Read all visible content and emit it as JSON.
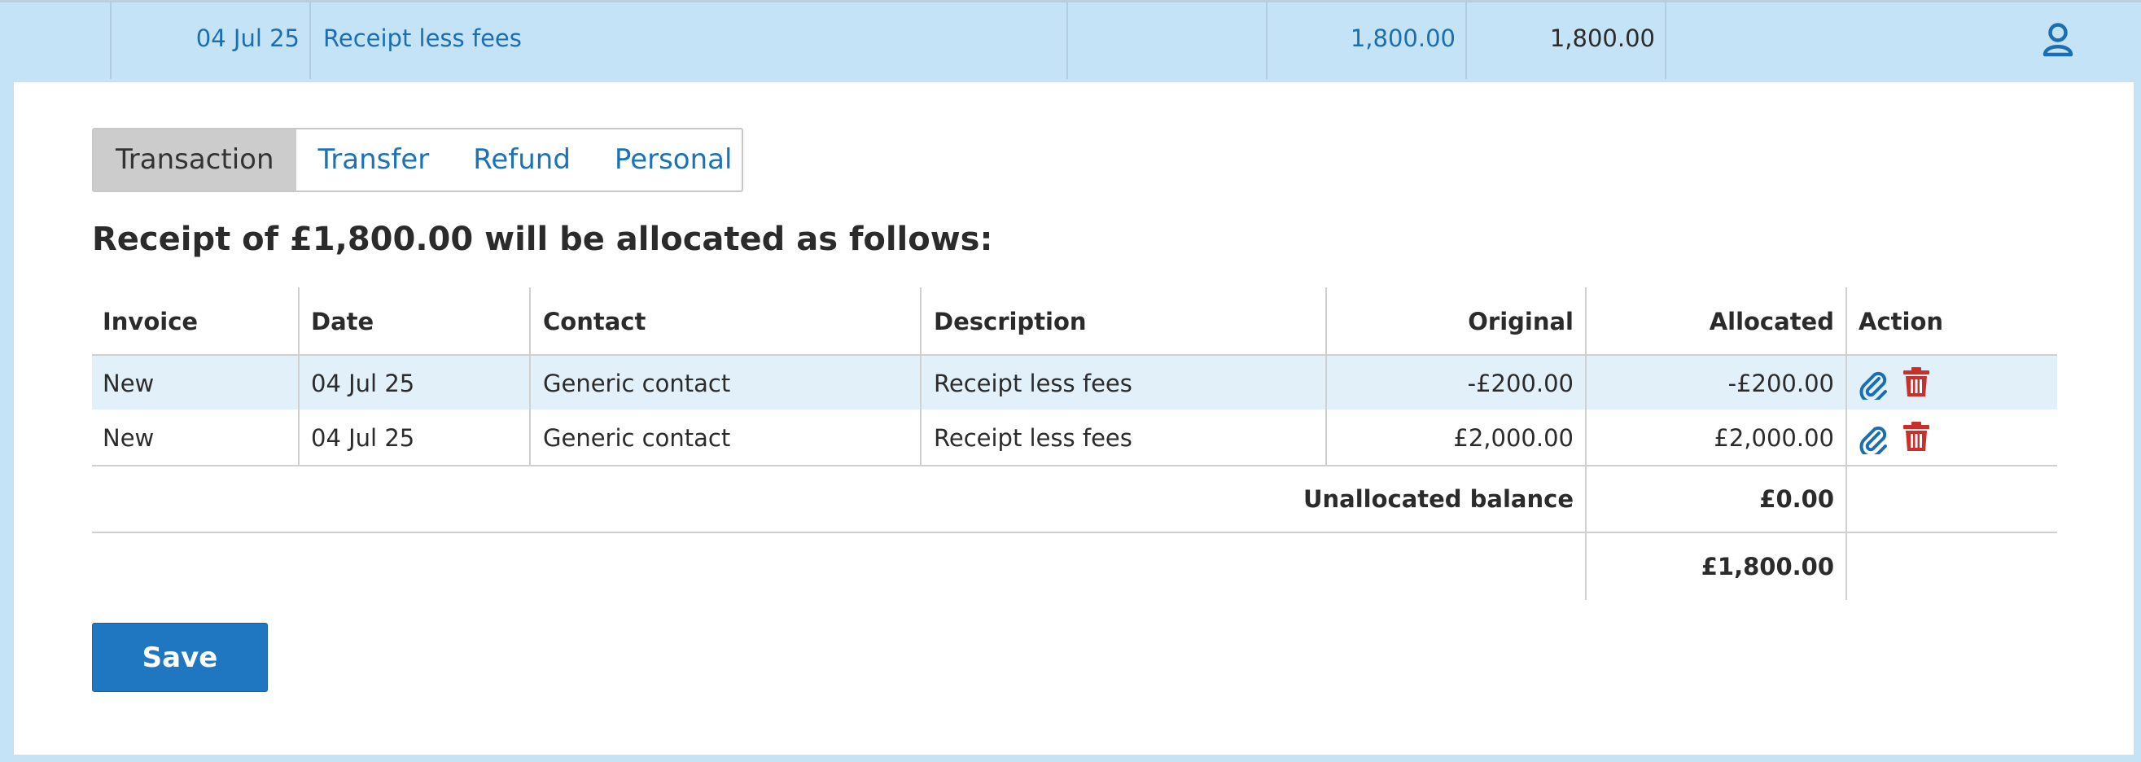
{
  "summary_row": {
    "date": "04 Jul 25",
    "description": "Receipt less fees",
    "amount_in": "1,800.00",
    "balance": "1,800.00",
    "icon": "user-icon"
  },
  "tabs": [
    {
      "label": "Transaction",
      "active": true
    },
    {
      "label": "Transfer",
      "active": false
    },
    {
      "label": "Refund",
      "active": false
    },
    {
      "label": "Personal",
      "active": false
    }
  ],
  "heading": "Receipt of £1,800.00 will be allocated as follows:",
  "table": {
    "columns": [
      "Invoice",
      "Date",
      "Contact",
      "Description",
      "Original",
      "Allocated",
      "Action"
    ],
    "rows": [
      {
        "invoice": "New",
        "date": "04 Jul 25",
        "contact": "Generic contact",
        "description": "Receipt less fees",
        "original": "-£200.00",
        "allocated": "-£200.00"
      },
      {
        "invoice": "New",
        "date": "04 Jul 25",
        "contact": "Generic contact",
        "description": "Receipt less fees",
        "original": "£2,000.00",
        "allocated": "£2,000.00"
      }
    ],
    "unallocated_label": "Unallocated balance",
    "unallocated_value": "£0.00",
    "total_value": "£1,800.00",
    "action_icons": [
      "paperclip-icon",
      "trash-icon"
    ]
  },
  "save_label": "Save",
  "colors": {
    "row_highlight": "#c5e3f6",
    "link_blue": "#1a6fb3",
    "save_button": "#1f77c2",
    "delete_red": "#c9302c",
    "selected_row": "#e2f0f9"
  }
}
